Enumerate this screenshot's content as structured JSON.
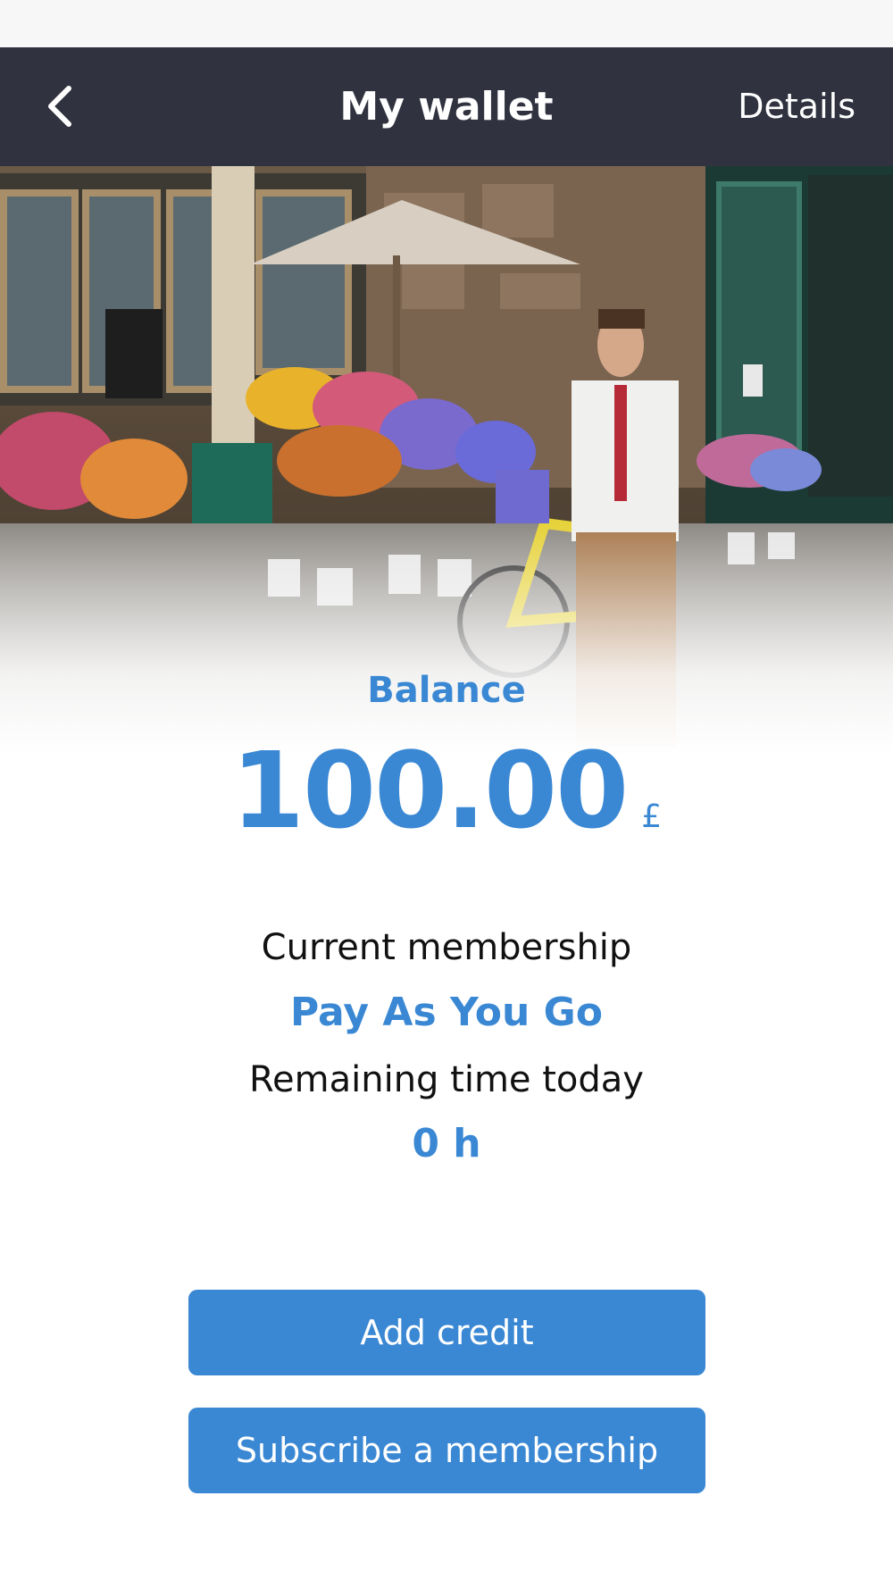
{
  "header": {
    "back_icon": "chevron-left-icon",
    "title": "My wallet",
    "details_label": "Details",
    "background_color": "#30323f"
  },
  "hero": {
    "image": "man with yellow bicycle in front of flower stall"
  },
  "balance": {
    "label": "Balance",
    "amount": "100.00",
    "currency": "£"
  },
  "membership": {
    "label": "Current membership",
    "value": "Pay As You Go"
  },
  "remaining": {
    "label": "Remaining time today",
    "value": "0 h"
  },
  "actions": {
    "add_credit_label": "Add credit",
    "subscribe_label": "Subscribe a membership"
  },
  "colors": {
    "accent": "#3a88d4",
    "text": "#111111",
    "nav_bg": "#30323f"
  }
}
